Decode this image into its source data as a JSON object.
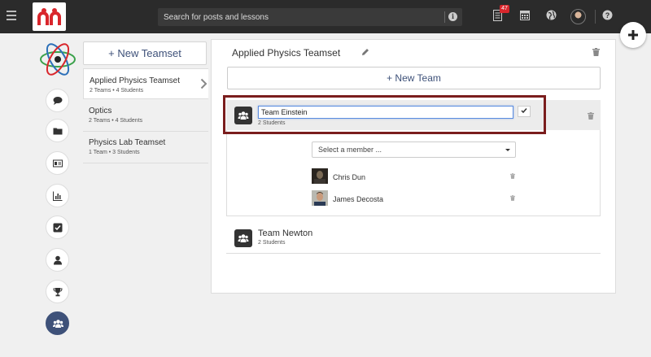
{
  "topbar": {
    "search_placeholder": "Search for posts and lessons",
    "notification_count": "47"
  },
  "sidebar": {
    "new_teamset_label": "+ New Teamset",
    "teamsets": [
      {
        "name": "Applied Physics Teamset",
        "meta": "2 Teams • 4 Students"
      },
      {
        "name": "Optics",
        "meta": "2 Teams • 4 Students"
      },
      {
        "name": "Physics Lab Teamset",
        "meta": "1 Team • 3 Students"
      }
    ]
  },
  "main": {
    "title": "Applied Physics Teamset",
    "new_team_label": "+ New Team",
    "teams": [
      {
        "name_value": "Team Einstein",
        "meta": "2 Students",
        "select_placeholder": "Select a member ...",
        "members": [
          "Chris Dun",
          "James Decosta"
        ]
      },
      {
        "name": "Team Newton",
        "meta": "2 Students"
      }
    ]
  },
  "colors": {
    "accent": "#3e5179",
    "brand_red": "#d9262c",
    "highlight": "#7a1d1d"
  }
}
